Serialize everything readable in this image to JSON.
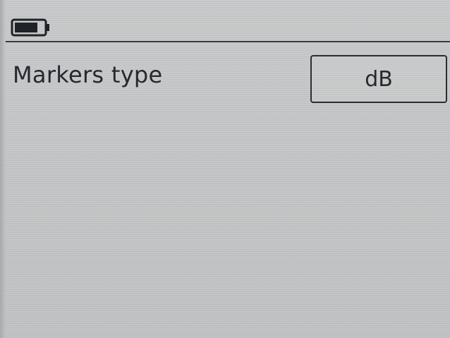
{
  "status_bar": {
    "battery_icon": "battery-icon",
    "battery_level": 0.8
  },
  "settings": {
    "markers_type": {
      "label": "Markers type",
      "value": "dB"
    }
  },
  "colors": {
    "background": "#c4c6c7",
    "text": "#25292d",
    "border": "#2b2f33"
  }
}
